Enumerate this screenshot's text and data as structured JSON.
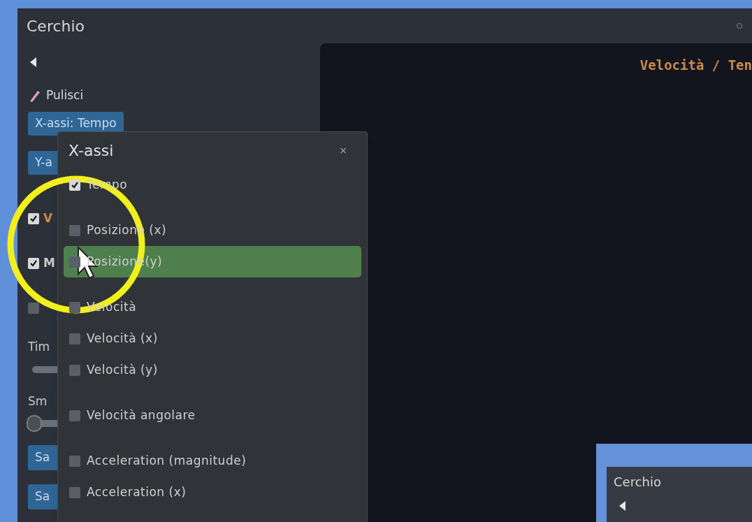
{
  "window": {
    "title": "Cerchio"
  },
  "sidebar": {
    "clear_label": "Pulisci",
    "axis_buttons": [
      "X-assi: Tempo",
      "Y-a"
    ],
    "checkboxes": [
      {
        "label": "V",
        "checked": true,
        "color": "#c98a4a"
      },
      {
        "label": "M",
        "checked": true,
        "color": "#c8c8c8"
      },
      {
        "checked": false
      }
    ],
    "sliders": [
      {
        "label": "Tim"
      },
      {
        "label": "Sm",
        "level": 0
      }
    ],
    "save_buttons": [
      "Sa",
      "Sa"
    ]
  },
  "chart": {
    "title": "Velocità / Ten"
  },
  "popup": {
    "title": "X-assi",
    "close": "×",
    "groups": [
      [
        {
          "label": "Tempo",
          "checked": true,
          "selected": false
        }
      ],
      [
        {
          "label": "Posizione (x)",
          "checked": false,
          "selected": false
        },
        {
          "label": "Posizione(y)",
          "checked": false,
          "selected": true
        }
      ],
      [
        {
          "label": "Velocità",
          "checked": false,
          "selected": false
        },
        {
          "label": "Velocità (x)",
          "checked": false,
          "selected": false
        },
        {
          "label": "Velocità (y)",
          "checked": false,
          "selected": false
        }
      ],
      [
        {
          "label": "Velocità angolare",
          "checked": false,
          "selected": false
        }
      ],
      [
        {
          "label": "Acceleration (magnitude)",
          "checked": false,
          "selected": false
        },
        {
          "label": "Acceleration (x)",
          "checked": false,
          "selected": false
        }
      ]
    ]
  },
  "nested_window": {
    "title": "Cerchio"
  }
}
